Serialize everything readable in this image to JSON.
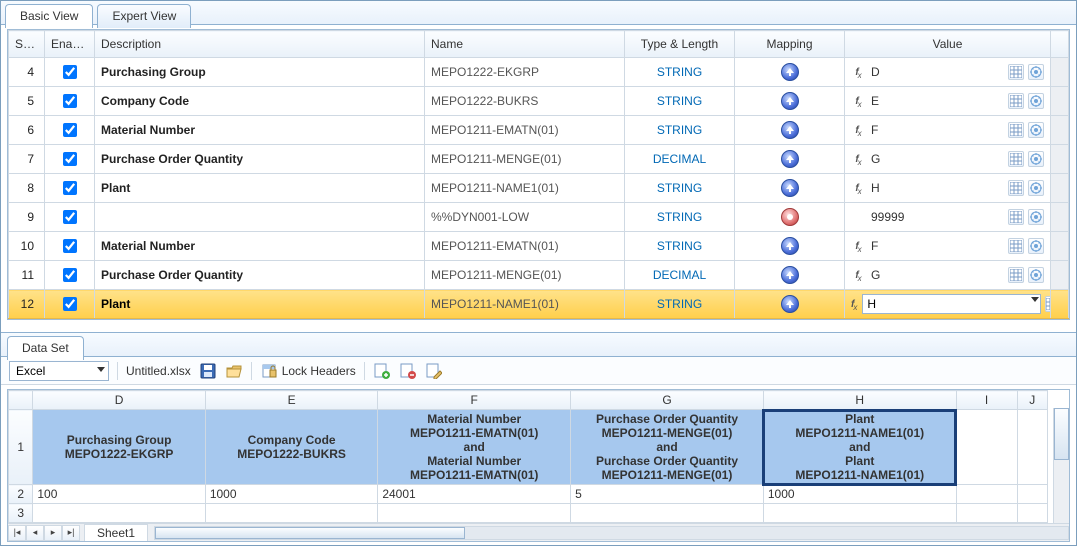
{
  "tabs": {
    "basic": "Basic View",
    "expert": "Expert View"
  },
  "columns": {
    "sno": "S.No",
    "enable": "Enable",
    "desc": "Description",
    "name": "Name",
    "type": "Type & Length",
    "mapping": "Mapping",
    "value": "Value"
  },
  "rows": [
    {
      "sno": "4",
      "enable": true,
      "desc": "Purchasing Group",
      "name": "MEPO1222-EKGRP",
      "type": "STRING",
      "map": "up",
      "val": "D",
      "fx": true
    },
    {
      "sno": "5",
      "enable": true,
      "desc": "Company Code",
      "name": "MEPO1222-BUKRS",
      "type": "STRING",
      "map": "up",
      "val": "E",
      "fx": true
    },
    {
      "sno": "6",
      "enable": true,
      "desc": "Material Number",
      "name": "MEPO1211-EMATN(01)",
      "type": "STRING",
      "map": "up",
      "val": "F",
      "fx": true
    },
    {
      "sno": "7",
      "enable": true,
      "desc": "Purchase Order Quantity",
      "name": "MEPO1211-MENGE(01)",
      "type": "DECIMAL",
      "map": "up",
      "val": "G",
      "fx": true
    },
    {
      "sno": "8",
      "enable": true,
      "desc": "Plant",
      "name": "MEPO1211-NAME1(01)",
      "type": "STRING",
      "map": "up",
      "val": "H",
      "fx": true
    },
    {
      "sno": "9",
      "enable": true,
      "desc": "",
      "name": "%%DYN001-LOW",
      "type": "STRING",
      "map": "none",
      "val": "99999",
      "fx": false
    },
    {
      "sno": "10",
      "enable": true,
      "desc": "Material Number",
      "name": "MEPO1211-EMATN(01)",
      "type": "STRING",
      "map": "up",
      "val": "F",
      "fx": true
    },
    {
      "sno": "11",
      "enable": true,
      "desc": "Purchase Order Quantity",
      "name": "MEPO1211-MENGE(01)",
      "type": "DECIMAL",
      "map": "up",
      "val": "G",
      "fx": true
    },
    {
      "sno": "12",
      "enable": true,
      "desc": "Plant",
      "name": "MEPO1211-NAME1(01)",
      "type": "STRING",
      "map": "up",
      "val": "H",
      "fx": true,
      "selected": true,
      "editing": true
    }
  ],
  "dataset": {
    "tab": "Data Set",
    "source": "Excel",
    "filename": "Untitled.xlsx",
    "lock": "Lock Headers",
    "cols": [
      "D",
      "E",
      "F",
      "G",
      "H",
      "I",
      "J"
    ],
    "headers": [
      "Purchasing Group\nMEPO1222-EKGRP",
      "Company Code\nMEPO1222-BUKRS",
      "Material Number\nMEPO1211-EMATN(01)\nand\nMaterial Number\nMEPO1211-EMATN(01)",
      "Purchase Order Quantity\nMEPO1211-MENGE(01)\nand\nPurchase Order Quantity\nMEPO1211-MENGE(01)",
      "Plant\nMEPO1211-NAME1(01)\nand\nPlant\nMEPO1211-NAME1(01)",
      "",
      ""
    ],
    "activeHeader": 4,
    "row1": "1",
    "row2": "2",
    "row3": "3",
    "data": [
      "100",
      "1000",
      "24001",
      "5",
      "1000",
      "",
      ""
    ],
    "sheet": "Sheet1"
  }
}
